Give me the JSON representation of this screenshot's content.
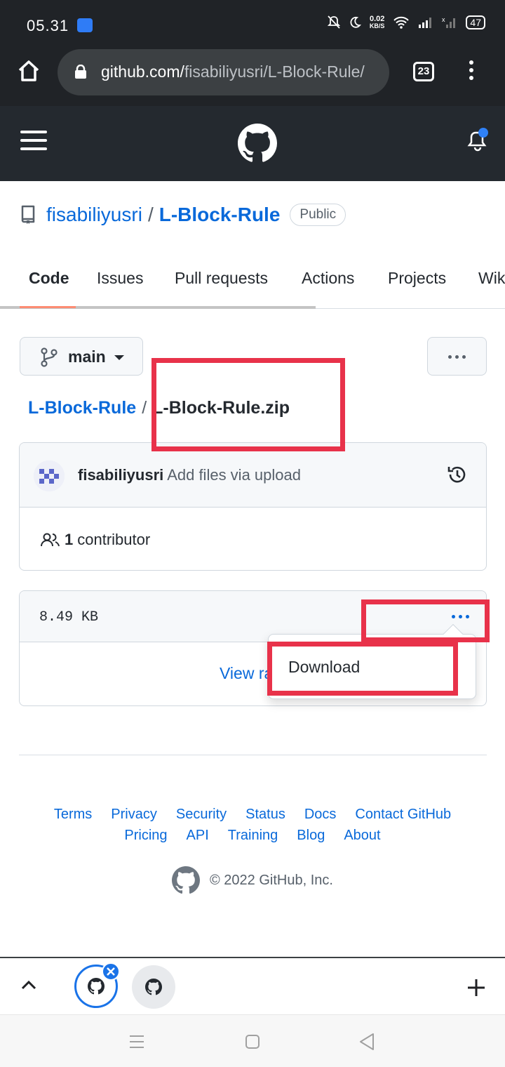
{
  "status_bar": {
    "time": "05.31",
    "net_speed": "0.02",
    "net_unit": "KB/S",
    "battery": "47"
  },
  "browser": {
    "url_host": "github.com/",
    "url_path": "fisabiliyusri/L-Block-Rule/",
    "tab_count": "23"
  },
  "repo": {
    "owner": "fisabiliyusri",
    "separator": "/",
    "name": "L-Block-Rule",
    "visibility": "Public"
  },
  "tabs": [
    {
      "label": "Code"
    },
    {
      "label": "Issues"
    },
    {
      "label": "Pull requests"
    },
    {
      "label": "Actions"
    },
    {
      "label": "Projects"
    },
    {
      "label": "Wik"
    }
  ],
  "branch": {
    "label": "main"
  },
  "breadcrumb": {
    "repo": "L-Block-Rule",
    "separator": "/",
    "file": "L-Block-Rule.zip"
  },
  "commit": {
    "author": "fisabiliyusri",
    "message": "Add files via upload"
  },
  "contributors": {
    "count": "1",
    "label": "contributor"
  },
  "file": {
    "size": "8.49 KB",
    "view_raw": "View raw",
    "menu_item": "Download"
  },
  "footer": {
    "row1": [
      "Terms",
      "Privacy",
      "Security",
      "Status",
      "Docs",
      "Contact GitHub"
    ],
    "row2": [
      "Pricing",
      "API",
      "Training",
      "Blog",
      "About"
    ],
    "copyright": "© 2022 GitHub, Inc."
  },
  "colors": {
    "link": "#0969da",
    "header": "#24292f",
    "annotation_red": "#e8324a",
    "tab_underline": "#fd8c73"
  }
}
